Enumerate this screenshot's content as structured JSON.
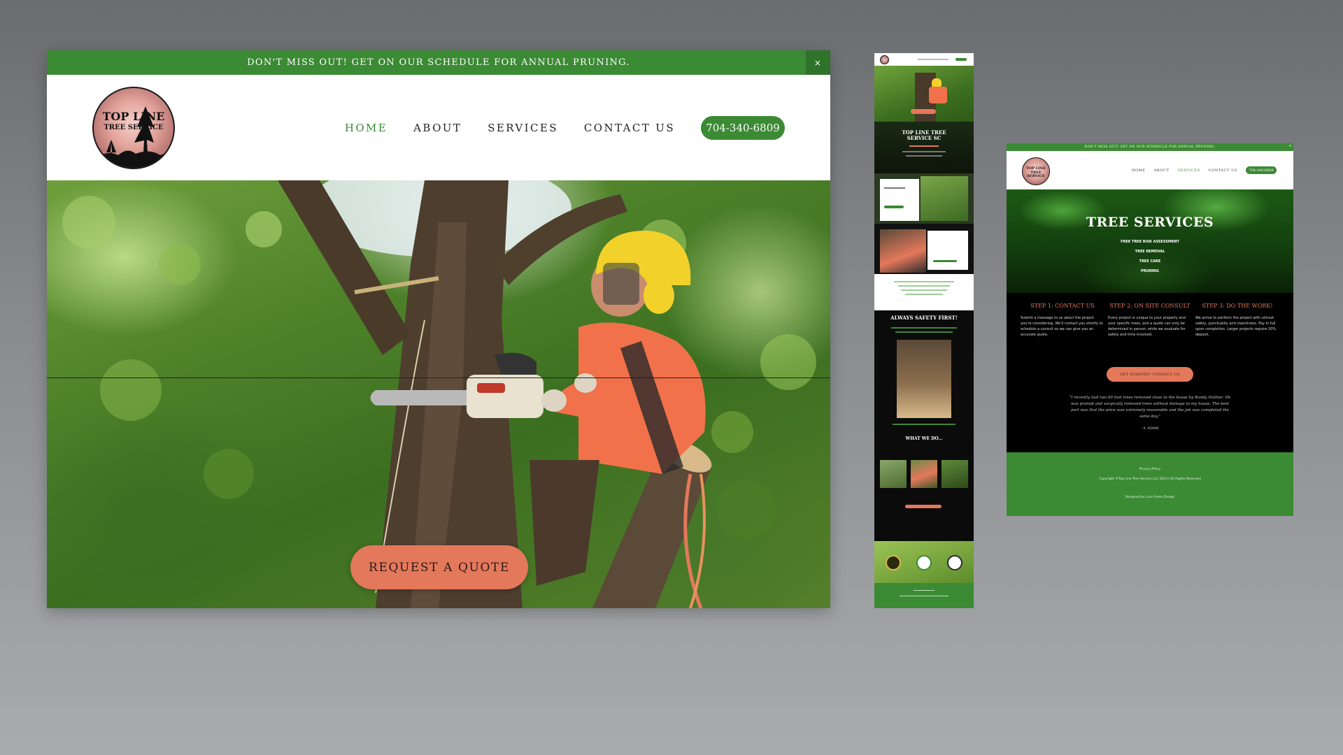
{
  "main": {
    "announcement": "DON'T MISS OUT! GET ON OUR SCHEDULE FOR ANNUAL PRUNING.",
    "close_label": "×",
    "logo_line1": "TOP LINE",
    "logo_line2": "TREE SERVICE",
    "nav": {
      "home": "HOME",
      "about": "ABOUT",
      "services": "SERVICES",
      "contact": "CONTACT US",
      "phone": "704-340-6809"
    },
    "hero_button": "REQUEST A QUOTE"
  },
  "mobile": {
    "hero_title": "TOP LINE TREE SERVICE SC",
    "safety_title": "ALWAYS SAFETY FIRST!",
    "what_title": "WHAT WE DO..."
  },
  "services_page": {
    "announcement": "DON'T MISS OUT! GET ON OUR SCHEDULE FOR ANNUAL PRUNING.",
    "close_label": "×",
    "logo": "TOP LINE TREE SERVICE",
    "nav": {
      "home": "HOME",
      "about": "ABOUT",
      "services": "SERVICES",
      "contact": "CONTACT US",
      "phone": "704-340-6809"
    },
    "title": "TREE SERVICES",
    "items": [
      "FREE TREE RISK ASSESSMENT",
      "TREE REMOVAL",
      "TREE CARE",
      "PRUNING"
    ],
    "steps": [
      {
        "title": "STEP 1: CONTACT US",
        "body": "Submit a message to us about the project you're considering. We'll contact you shortly to schedule a consult so we can give you an accurate quote."
      },
      {
        "title": "STEP 2: ON SITE CONSULT",
        "body": "Every project is unique to your property and your specific trees, and a quote can only be determined in person, while we evaluate for safety and time involved."
      },
      {
        "title": "STEP 3: DO THE WORK!",
        "body": "We arrive to perform the project with utmost safety, punctuality and cleanliness. Pay in full upon completion. Larger projects require 20% deposit."
      }
    ],
    "cta": "GET STARTED! CONTACT US",
    "testimonial": "“I recently had two 60 foot trees removed close to the house by Randy Hallner. He was prompt and surgically removed trees without damage to my house. The best part was that the price was extremely reasonable and the job was completed the same day.”",
    "author": "- R. ADAMS",
    "footer": {
      "privacy": "Privacy Policy",
      "copyright": "Copyright ©Top Line Tree Service LLC 2023 | All Rights Reserved",
      "designed": "Designed by Lass Sreeo Design"
    }
  }
}
